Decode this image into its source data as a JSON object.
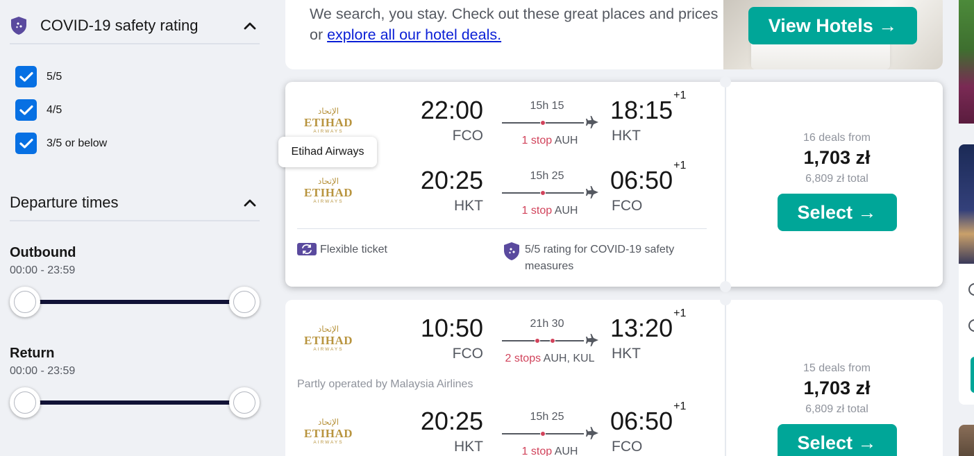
{
  "filters": {
    "covid": {
      "title": "COVID-19 safety rating",
      "options": [
        {
          "label": "5/5",
          "checked": true
        },
        {
          "label": "4/5",
          "checked": true
        },
        {
          "label": "3/5 or below",
          "checked": true
        }
      ]
    },
    "departure": {
      "title": "Departure times",
      "outbound": {
        "label": "Outbound",
        "range": "00:00 - 23:59"
      },
      "return": {
        "label": "Return",
        "range": "00:00 - 23:59"
      }
    }
  },
  "hotel_banner": {
    "text": "We search, you stay. Check out these great places and prices or ",
    "link": "explore all our hotel deals.",
    "button": "View Hotels →"
  },
  "tooltip": "Etihad Airways",
  "results": [
    {
      "legs": [
        {
          "dep_time": "22:00",
          "dep_airport": "FCO",
          "duration": "15h 15",
          "stops_label": "1 stop",
          "stops_via": "AUH",
          "arr_time": "18:15",
          "arr_offset": "+1",
          "arr_airport": "HKT"
        },
        {
          "dep_time": "20:25",
          "dep_airport": "HKT",
          "duration": "15h 25",
          "stops_label": "1 stop",
          "stops_via": "AUH",
          "arr_time": "06:50",
          "arr_offset": "+1",
          "arr_airport": "FCO"
        }
      ],
      "features": {
        "flexible": "Flexible ticket",
        "covid": "5/5 rating for COVID-19 safety measures"
      },
      "deals": "16 deals from",
      "price": "1,703 zł",
      "total": "6,809 zł total",
      "select": "Select →"
    },
    {
      "legs": [
        {
          "dep_time": "10:50",
          "dep_airport": "FCO",
          "duration": "21h 30",
          "stops_label": "2 stops",
          "stops_via": "AUH, KUL",
          "arr_time": "13:20",
          "arr_offset": "+1",
          "arr_airport": "HKT"
        },
        {
          "dep_time": "20:25",
          "dep_airport": "HKT",
          "duration": "15h 25",
          "stops_label": "1 stop",
          "stops_via": "AUH",
          "arr_time": "06:50",
          "arr_offset": "+1",
          "arr_airport": "FCO"
        }
      ],
      "partly": "Partly operated by Malaysia Airlines",
      "deals": "15 deals from",
      "price": "1,703 zł",
      "total": "6,809 zł total",
      "select": "Select →"
    }
  ],
  "airline_logo": {
    "arabic": "الإتحاد",
    "name": "ETIHAD",
    "sub": "AIRWAYS"
  },
  "colors": {
    "accent": "#00a698",
    "checkbox": "#0770e3",
    "stop_red": "#d1435b",
    "track": "#111236",
    "covid_purple": "#5a4a9e"
  }
}
